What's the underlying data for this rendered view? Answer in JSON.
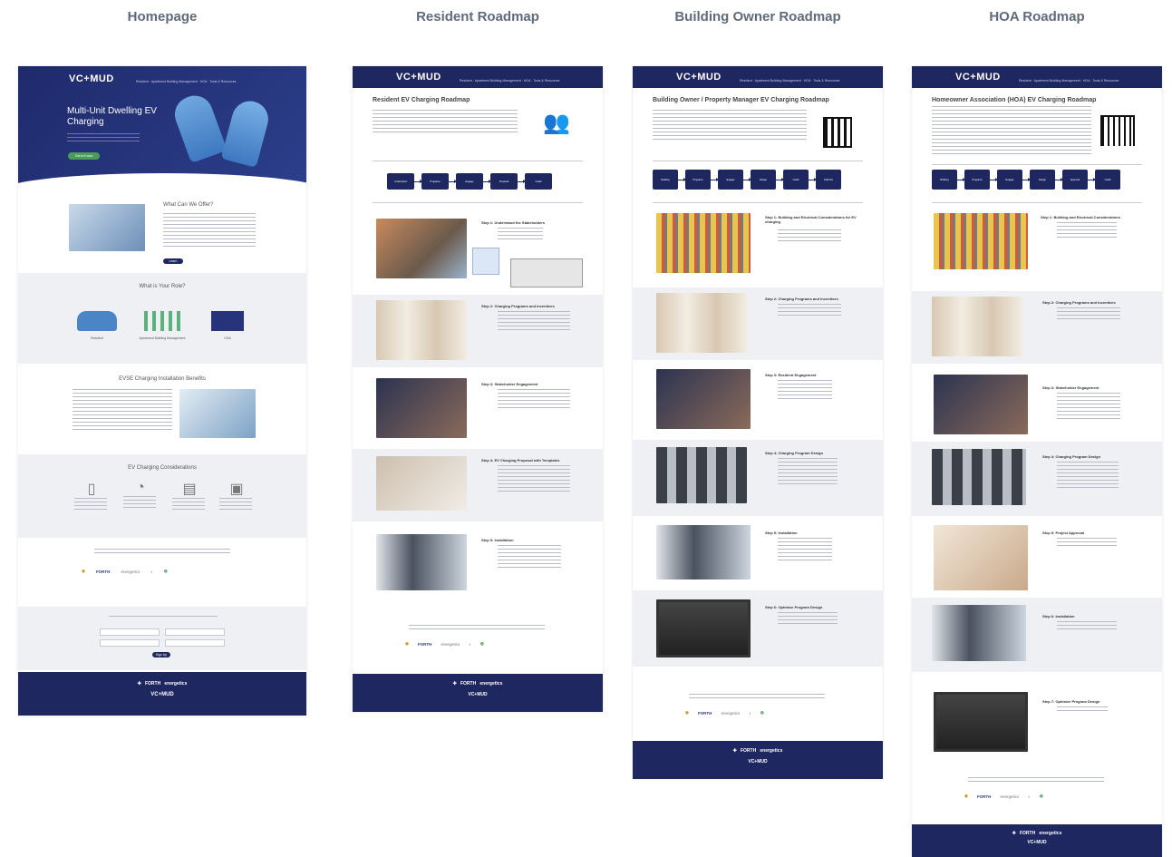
{
  "columns": [
    {
      "title": "Homepage"
    },
    {
      "title": "Resident Roadmap"
    },
    {
      "title": "Building Owner Roadmap"
    },
    {
      "title": "HOA Roadmap"
    }
  ],
  "brand": {
    "logo": "VC+MUD",
    "nav_color": "#1f2760",
    "accent_green": "#4b9b5a"
  },
  "homepage": {
    "hero_title": "Multi-Unit Dwelling EV Charging",
    "offer_title": "What Can We Offer?",
    "role_title": "What is Your Role?",
    "roles": [
      "Resident",
      "Apartment Building Management",
      "HOA"
    ],
    "benefits_title": "EVSE Charging Installation Benefits",
    "considerations_title": "EV Charging Considerations",
    "partners": [
      "FORTH",
      "energetics"
    ],
    "footer_logo": "VC+MUD"
  },
  "resident": {
    "title": "Resident EV Charging Roadmap",
    "steps": [
      "Step 1: Understand the Stakeholders",
      "Step 2: Charging Programs and Incentives",
      "Step 3: Stakeholder Engagement",
      "Step 4: EV Charging Proposal with Templates",
      "Step 5: Installation"
    ],
    "partners": [
      "FORTH",
      "energetics"
    ]
  },
  "owner": {
    "title": "Building Owner / Property Manager EV Charging Roadmap",
    "steps": [
      "Step 1: Building and Electrical Considerations for EV charging",
      "Step 2: Charging Programs and Incentives",
      "Step 3: Resident Engagement",
      "Step 4: Charging Program Design",
      "Step 5: Installation",
      "Step 6: Optimize Program Design"
    ],
    "partners": [
      "FORTH",
      "energetics"
    ]
  },
  "hoa": {
    "title": "Homeowner Association (HOA) EV Charging Roadmap",
    "steps": [
      "Step 1: Building and Electrical Considerations",
      "Step 2: Charging Programs and Incentives",
      "Step 3: Stakeholder Engagement",
      "Step 4: Charging Program Design",
      "Step 5: Project Approval",
      "Step 6: Installation",
      "Step 7: Optimize Program Design"
    ],
    "partners": [
      "FORTH",
      "energetics"
    ]
  }
}
